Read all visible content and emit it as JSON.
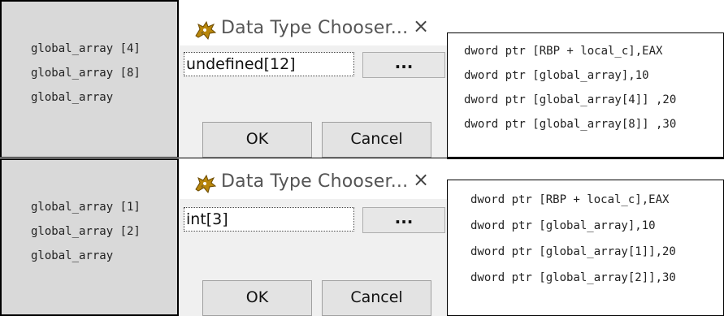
{
  "panels": [
    {
      "symbols": [
        "global_array [4]",
        "global_array [8]",
        "global_array"
      ],
      "dialog": {
        "title": "Data Type Chooser...",
        "close_glyph": "×",
        "input_value": "undefined[12]",
        "browse_label": "...",
        "ok_label": "OK",
        "cancel_label": "Cancel"
      },
      "code_lines": [
        "dword ptr [RBP + local_c],EAX",
        "dword ptr [global_array],10",
        "dword ptr [global_array[4]] ,20",
        "dword ptr [global_array[8]] ,30"
      ]
    },
    {
      "symbols": [
        "global_array [1]",
        "global_array [2]",
        "global_array"
      ],
      "dialog": {
        "title": "Data Type Chooser...",
        "close_glyph": "×",
        "input_value": "int[3]",
        "browse_label": "...",
        "ok_label": "OK",
        "cancel_label": "Cancel"
      },
      "code_lines": [
        "dword ptr [RBP + local_c],EAX",
        "dword ptr [global_array],10",
        "dword ptr [global_array[1]],20",
        "dword ptr [global_array[2]],30"
      ]
    }
  ],
  "icons": {
    "dialog_icon": "dragon-icon"
  }
}
